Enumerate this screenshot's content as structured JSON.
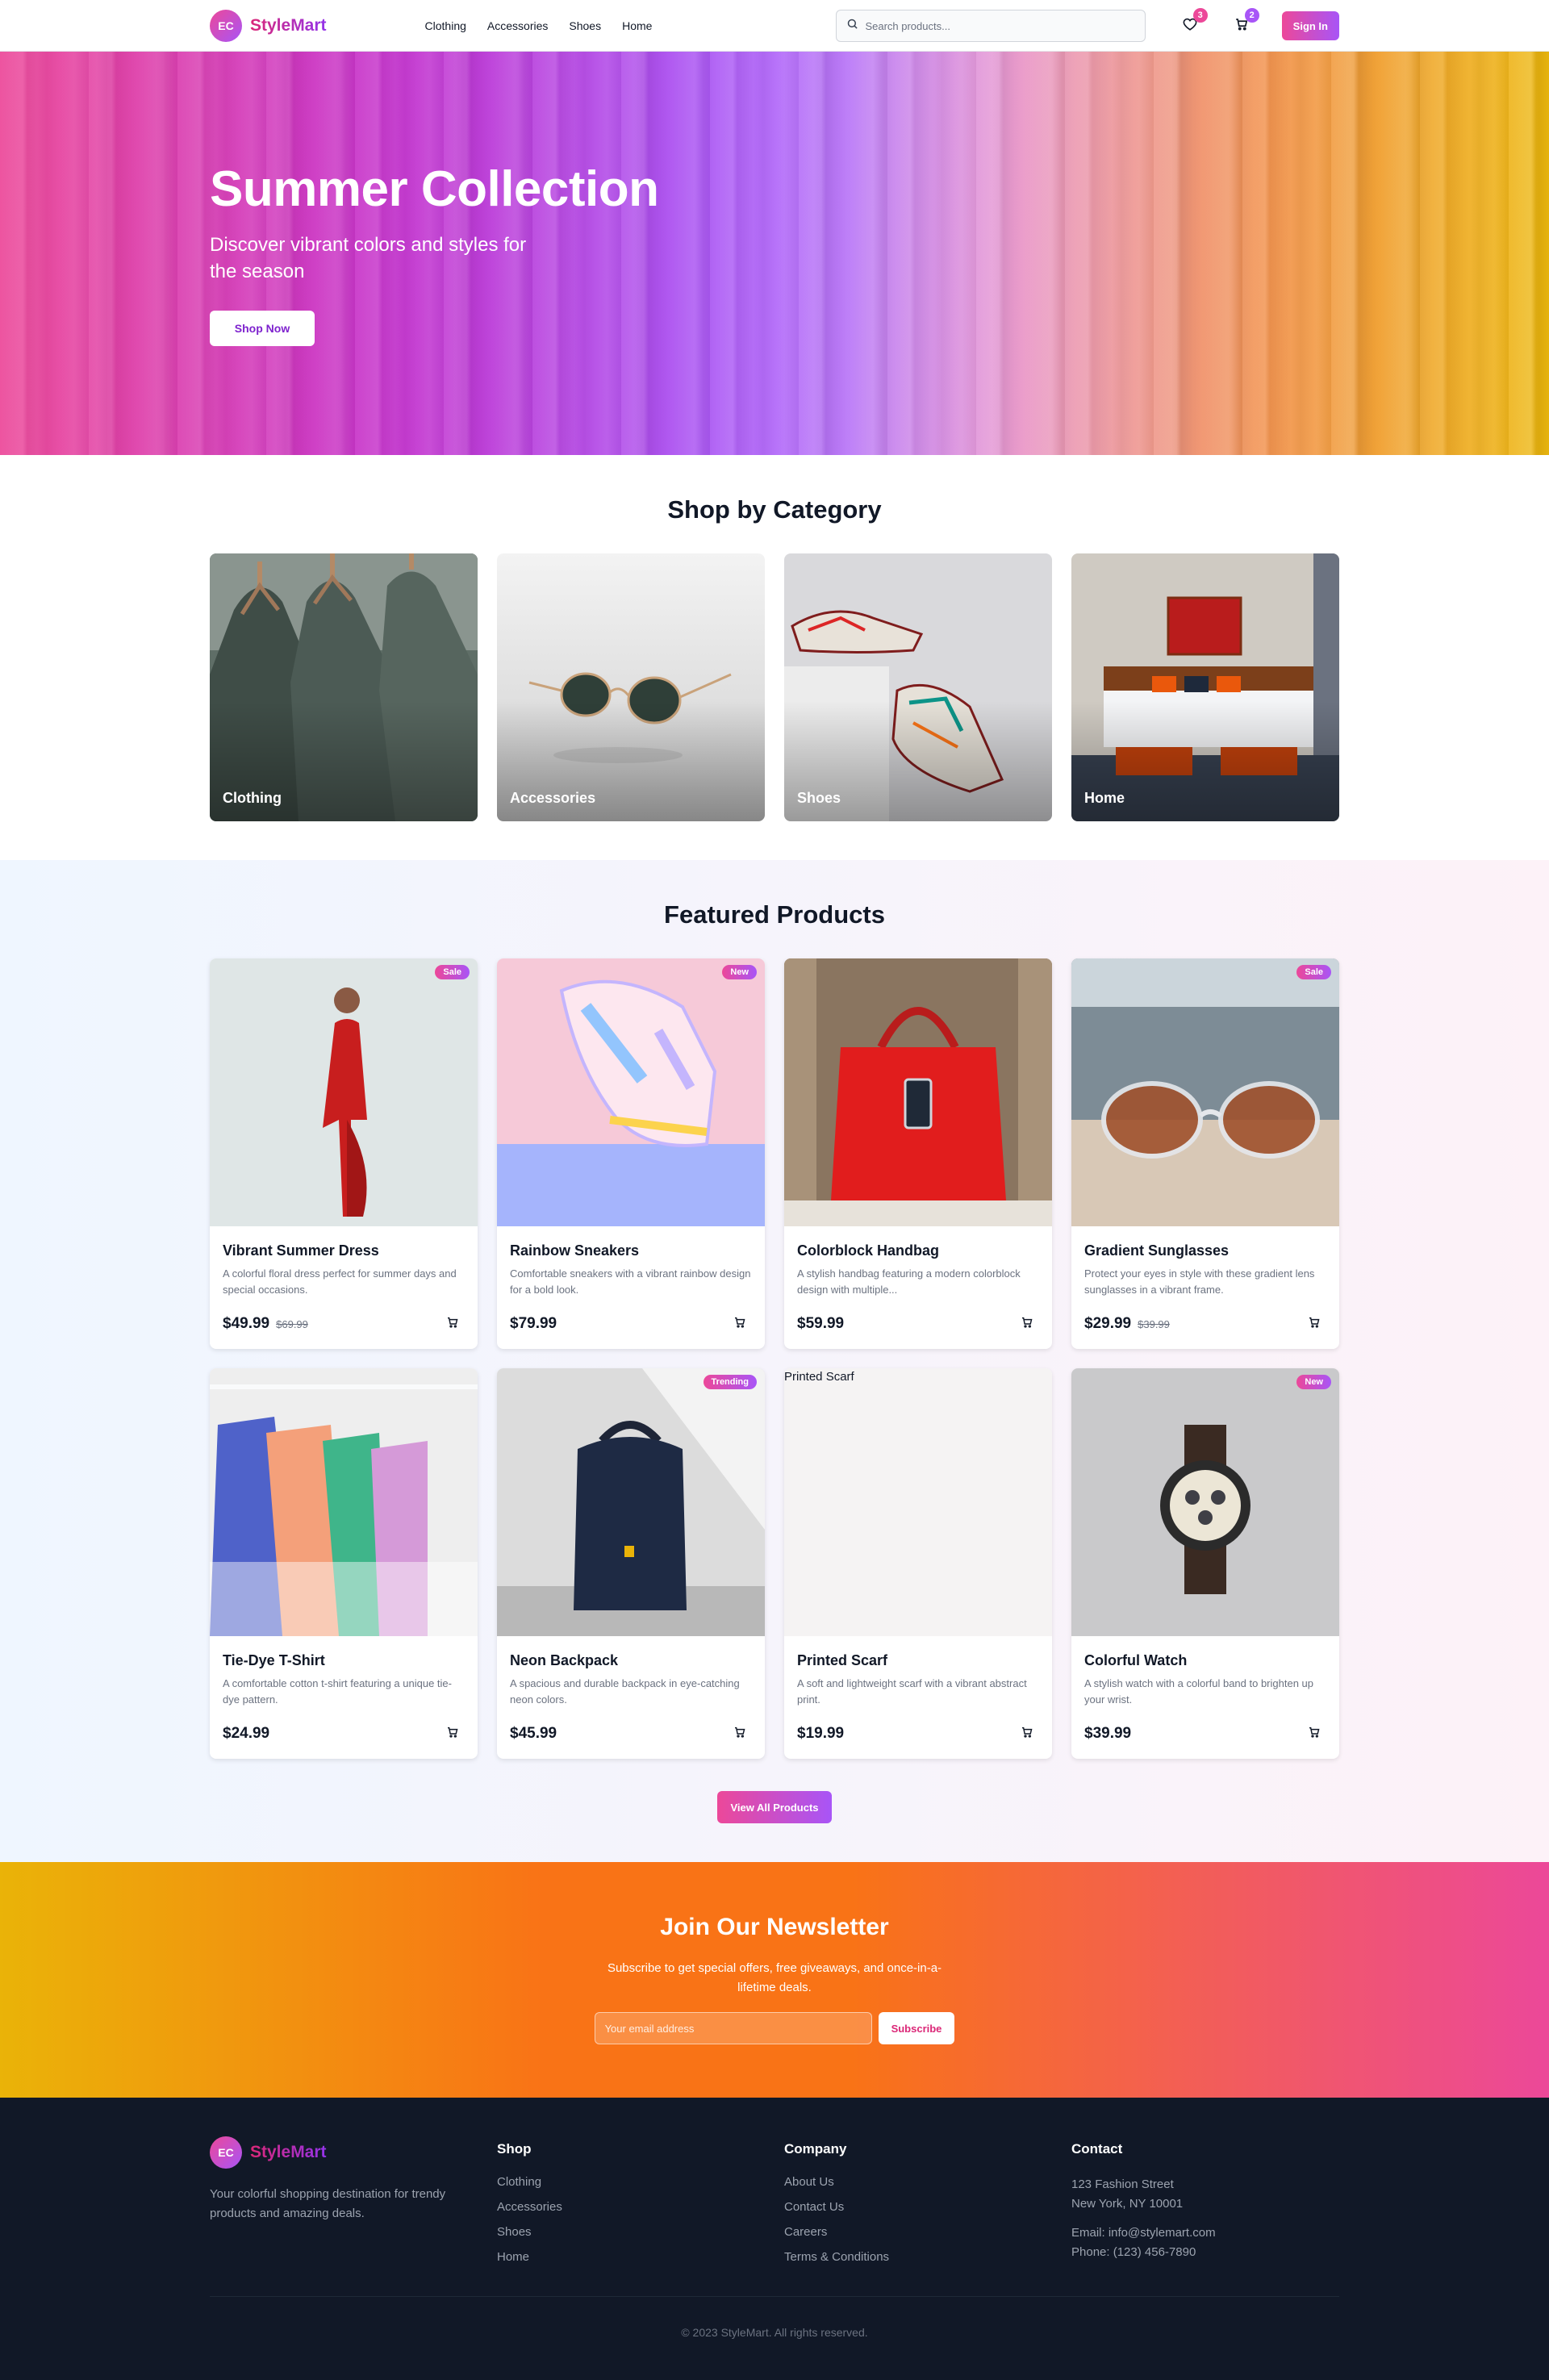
{
  "nav": {
    "logo_initials": "EC",
    "brand": "StyleMart",
    "links": [
      "Clothing",
      "Accessories",
      "Shoes",
      "Home"
    ],
    "search_placeholder": "Search products...",
    "wishlist_count": "3",
    "cart_count": "2",
    "signin_label": "Sign In"
  },
  "hero": {
    "title": "Summer Collection",
    "subtitle": "Discover vibrant colors and styles for the season",
    "cta_label": "Shop Now"
  },
  "categories": {
    "title": "Shop by Category",
    "items": [
      {
        "label": "Clothing"
      },
      {
        "label": "Accessories"
      },
      {
        "label": "Shoes"
      },
      {
        "label": "Home"
      }
    ]
  },
  "featured": {
    "title": "Featured Products",
    "products": [
      {
        "name": "Vibrant Summer Dress",
        "desc": "A colorful floral dress perfect for summer days and special occasions.",
        "price": "$49.99",
        "old_price": "$69.99",
        "tag": "Sale"
      },
      {
        "name": "Rainbow Sneakers",
        "desc": "Comfortable sneakers with a vibrant rainbow design for a bold look.",
        "price": "$79.99",
        "old_price": "",
        "tag": "New"
      },
      {
        "name": "Colorblock Handbag",
        "desc": "A stylish handbag featuring a modern colorblock design with multiple...",
        "price": "$59.99",
        "old_price": "",
        "tag": ""
      },
      {
        "name": "Gradient Sunglasses",
        "desc": "Protect your eyes in style with these gradient lens sunglasses in a vibrant frame.",
        "price": "$29.99",
        "old_price": "$39.99",
        "tag": "Sale"
      },
      {
        "name": "Tie-Dye T-Shirt",
        "desc": "A comfortable cotton t-shirt featuring a unique tie-dye pattern.",
        "price": "$24.99",
        "old_price": "",
        "tag": ""
      },
      {
        "name": "Neon Backpack",
        "desc": "A spacious and durable backpack in eye-catching neon colors.",
        "price": "$45.99",
        "old_price": "",
        "tag": "Trending"
      },
      {
        "name": "Printed Scarf",
        "desc": "A soft and lightweight scarf with a vibrant abstract print.",
        "price": "$19.99",
        "old_price": "",
        "tag": "",
        "img_alt": "Printed Scarf"
      },
      {
        "name": "Colorful Watch",
        "desc": "A stylish watch with a colorful band to brighten up your wrist.",
        "price": "$39.99",
        "old_price": "",
        "tag": "New"
      }
    ],
    "view_all_label": "View All Products"
  },
  "newsletter": {
    "title": "Join Our Newsletter",
    "text": "Subscribe to get special offers, free giveaways, and once-in-a-lifetime deals.",
    "email_placeholder": "Your email address",
    "button_label": "Subscribe"
  },
  "footer": {
    "logo_initials": "EC",
    "brand": "StyleMart",
    "about": "Your colorful shopping destination for trendy products and amazing deals.",
    "shop": {
      "title": "Shop",
      "links": [
        "Clothing",
        "Accessories",
        "Shoes",
        "Home"
      ]
    },
    "company": {
      "title": "Company",
      "links": [
        "About Us",
        "Contact Us",
        "Careers",
        "Terms & Conditions"
      ]
    },
    "contact": {
      "title": "Contact",
      "address_line1": "123 Fashion Street",
      "address_line2": "New York, NY 10001",
      "email": "Email: info@stylemart.com",
      "phone": "Phone: (123) 456-7890"
    },
    "copyright": "© 2023 StyleMart. All rights reserved."
  },
  "colors": {
    "brand_pink": "#ec4899",
    "brand_purple": "#a855f7",
    "footer_bg": "#111827",
    "newsletter_orange": "#f97316",
    "newsletter_yellow": "#eab308"
  },
  "icons": [
    "search-icon",
    "heart-icon",
    "cart-icon"
  ]
}
